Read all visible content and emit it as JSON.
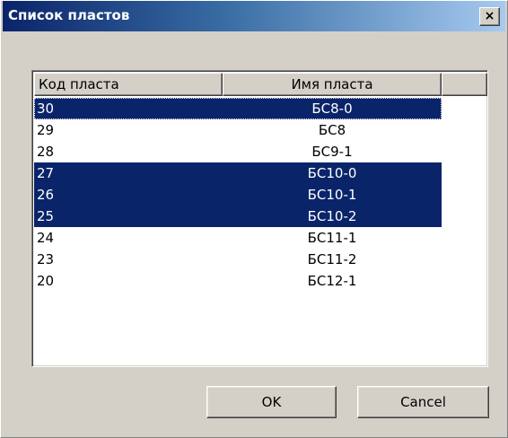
{
  "window": {
    "title": "Список пластов",
    "close_glyph": "×"
  },
  "list": {
    "columns": [
      "Код пласта",
      "Имя пласта",
      ""
    ],
    "rows": [
      {
        "code": "30",
        "name": "БС8-0",
        "selected": true,
        "focused": true
      },
      {
        "code": "29",
        "name": "БС8",
        "selected": false,
        "focused": false
      },
      {
        "code": "28",
        "name": "БС9-1",
        "selected": false,
        "focused": false
      },
      {
        "code": "27",
        "name": "БС10-0",
        "selected": true,
        "focused": false
      },
      {
        "code": "26",
        "name": "БС10-1",
        "selected": true,
        "focused": false
      },
      {
        "code": "25",
        "name": "БС10-2",
        "selected": true,
        "focused": false
      },
      {
        "code": "24",
        "name": "БС11-1",
        "selected": false,
        "focused": false
      },
      {
        "code": "23",
        "name": "БС11-2",
        "selected": false,
        "focused": false
      },
      {
        "code": "20",
        "name": "БС12-1",
        "selected": false,
        "focused": false
      }
    ]
  },
  "buttons": {
    "ok_label": "OK",
    "cancel_label": "Cancel"
  },
  "colors": {
    "selection": "#0a246a",
    "title_gradient_start": "#0a246a",
    "title_gradient_end": "#a6caf0",
    "face": "#d4d0c8"
  }
}
